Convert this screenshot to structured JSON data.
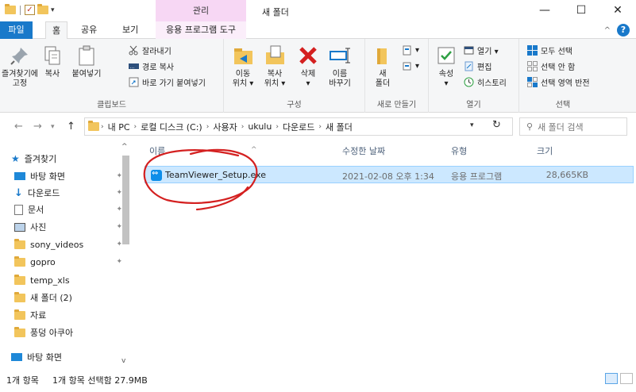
{
  "window": {
    "title": "새 폴더",
    "contextual_tab_header": "관리",
    "controls": {
      "minimize": "—",
      "maximize": "☐",
      "close": "✕"
    }
  },
  "tabs": {
    "file": "파일",
    "home": "홈",
    "share": "공유",
    "view": "보기",
    "app_tools": "응용 프로그램 도구"
  },
  "ribbon": {
    "clipboard": {
      "label": "클립보드",
      "pin": "즐겨찾기에\n고정",
      "pin_l1": "즐겨찾기에",
      "pin_l2": "고정",
      "copy": "복사",
      "paste": "붙여넣기",
      "cut": "잘라내기",
      "copy_path": "경로 복사",
      "paste_shortcut": "바로 가기 붙여넣기"
    },
    "organize": {
      "label": "구성",
      "move_l1": "이동",
      "move_l2": "위치 ▾",
      "copyto_l1": "복사",
      "copyto_l2": "위치 ▾",
      "delete_l1": "삭제",
      "delete_l2": "▾",
      "rename_l1": "이름",
      "rename_l2": "바꾸기"
    },
    "new": {
      "label": "새로 만들기",
      "newfolder_l1": "새",
      "newfolder_l2": "폴더"
    },
    "open": {
      "label": "열기",
      "props_l1": "속성",
      "props_l2": "▾",
      "open": "열기 ▾",
      "edit": "편집",
      "history": "히스토리"
    },
    "select": {
      "label": "선택",
      "select_all": "모두 선택",
      "select_none": "선택 안 함",
      "invert": "선택 영역 반전"
    }
  },
  "address": {
    "crumbs": [
      "내 PC",
      "로컬 디스크 (C:)",
      "사용자",
      "ukulu",
      "다운로드",
      "새 폴더"
    ],
    "search_placeholder": "새 폴더 검색"
  },
  "nav": {
    "items": [
      {
        "label": "즐겨찾기",
        "icon": "star-icon",
        "pinned": false
      },
      {
        "label": "바탕 화면",
        "icon": "desktop-icon",
        "pinned": true
      },
      {
        "label": "다운로드",
        "icon": "download-icon",
        "pinned": true
      },
      {
        "label": "문서",
        "icon": "document-icon",
        "pinned": true
      },
      {
        "label": "사진",
        "icon": "picture-icon",
        "pinned": true
      },
      {
        "label": "sony_videos",
        "icon": "folder-icon",
        "pinned": true
      },
      {
        "label": "gopro",
        "icon": "folder-icon",
        "pinned": true
      },
      {
        "label": "temp_xls",
        "icon": "folder-icon",
        "pinned": false
      },
      {
        "label": "새 폴더 (2)",
        "icon": "folder-icon",
        "pinned": false
      },
      {
        "label": "자료",
        "icon": "folder-icon",
        "pinned": false
      },
      {
        "label": "풍덩 아쿠아",
        "icon": "folder-icon",
        "pinned": false
      },
      {
        "label": "바탕 화면",
        "icon": "desktop-icon",
        "pinned": false
      }
    ]
  },
  "columns": {
    "name": "이름",
    "modified": "수정한 날짜",
    "type": "유형",
    "size": "크기"
  },
  "files": [
    {
      "name": "TeamViewer_Setup.exe",
      "modified": "2021-02-08 오후 1:34",
      "type": "응용 프로그램",
      "size": "28,665KB"
    }
  ],
  "status": {
    "count": "1개 항목",
    "selected": "1개 항목 선택함 27.9MB"
  },
  "colors": {
    "accent": "#1979ca",
    "selection": "#cce8ff",
    "annotation": "#d42020"
  }
}
